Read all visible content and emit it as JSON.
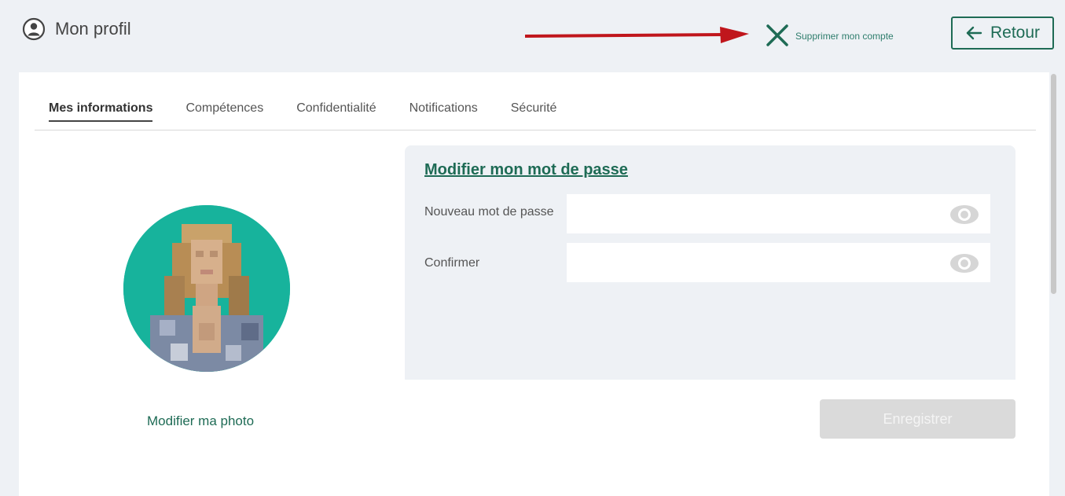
{
  "header": {
    "title": "Mon profil",
    "delete_account_label": "Supprimer mon compte",
    "back_label": "Retour"
  },
  "tabs": [
    {
      "label": "Mes informations",
      "active": true
    },
    {
      "label": "Compétences",
      "active": false
    },
    {
      "label": "Confidentialité",
      "active": false
    },
    {
      "label": "Notifications",
      "active": false
    },
    {
      "label": "Sécurité",
      "active": false
    }
  ],
  "profile": {
    "change_photo_label": "Modifier ma photo"
  },
  "password": {
    "title": "Modifier mon mot de passe",
    "new_password_label": "Nouveau mot de passe",
    "new_password_value": "",
    "confirm_label": "Confirmer",
    "confirm_value": ""
  },
  "save_label": "Enregistrer",
  "colors": {
    "accent": "#1e6b55",
    "background": "#eef1f5",
    "avatar_bg": "#17b39c",
    "annotation_arrow": "#c0161c"
  }
}
